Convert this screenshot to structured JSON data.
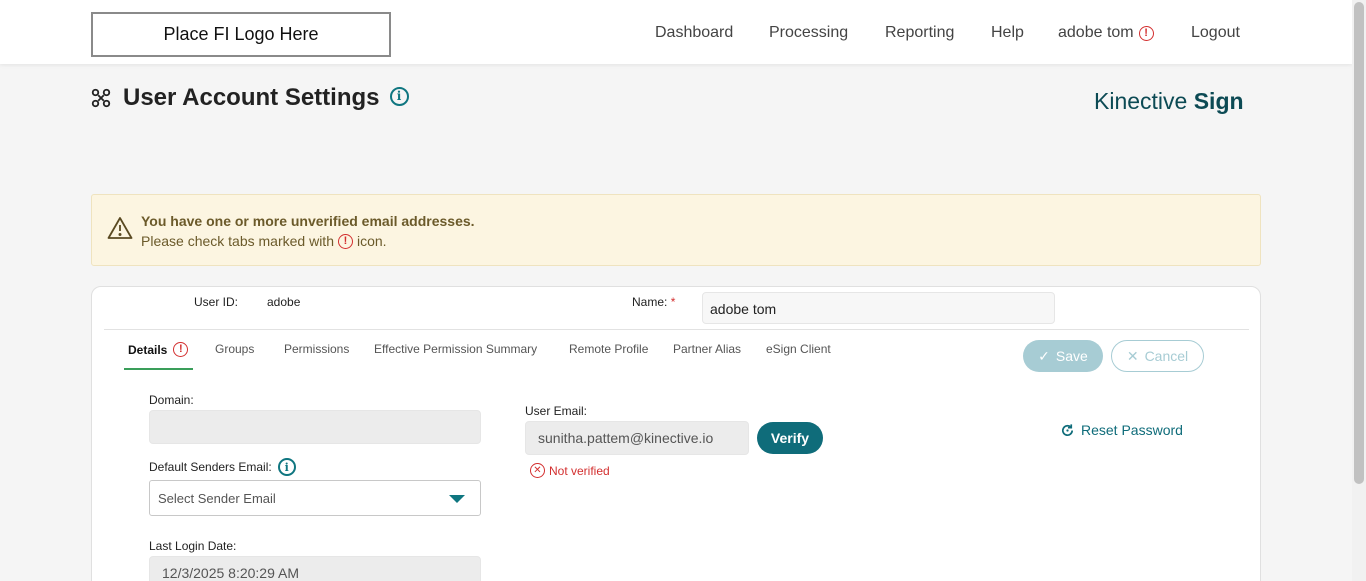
{
  "header": {
    "logo_text": "Place FI Logo Here",
    "nav": {
      "dashboard": "Dashboard",
      "processing": "Processing",
      "reporting": "Reporting",
      "help": "Help",
      "user": "adobe tom",
      "logout": "Logout"
    }
  },
  "page": {
    "title": "User Account Settings",
    "brand_light": "Kinective ",
    "brand_bold": "Sign"
  },
  "warning": {
    "line1": "You have one or more unverified email addresses.",
    "line2_before": "Please check tabs marked with",
    "line2_after": "icon."
  },
  "user": {
    "user_id_label": "User ID:",
    "user_id_value": "adobe",
    "name_label": "Name:",
    "required_mark": "*",
    "name_value": "adobe tom"
  },
  "tabs": [
    {
      "label": "Details"
    },
    {
      "label": "Groups"
    },
    {
      "label": "Permissions"
    },
    {
      "label": "Effective Permission Summary"
    },
    {
      "label": "Remote Profile"
    },
    {
      "label": "Partner Alias"
    },
    {
      "label": "eSign Client"
    }
  ],
  "actions": {
    "save": "Save",
    "cancel": "Cancel"
  },
  "details": {
    "domain_label": "Domain:",
    "domain_value": "",
    "default_senders_label": "Default Senders Email:",
    "default_senders_placeholder": "Select Sender Email",
    "last_login_label": "Last Login Date:",
    "last_login_value": "12/3/2025 8:20:29 AM",
    "user_email_label": "User Email:",
    "user_email_value": "sunitha.pattem@kinective.io",
    "verify": "Verify",
    "not_verified": "Not verified",
    "reset_password": "Reset Password"
  },
  "colors": {
    "accent": "#0f6c7a",
    "error": "#d32f2f",
    "warning_bg": "#fcf5e1",
    "active_tab": "#3a9e5a"
  }
}
